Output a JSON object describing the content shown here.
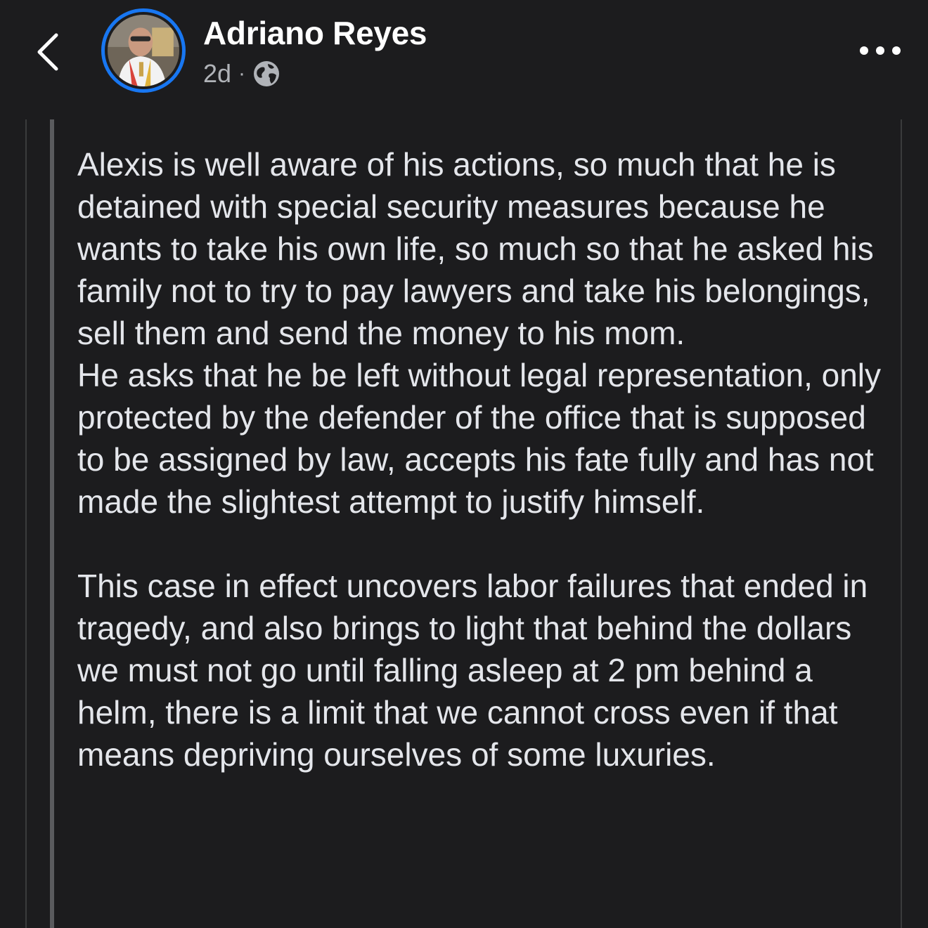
{
  "header": {
    "back_icon": "chevron-left-icon",
    "author_name": "Adriano Reyes",
    "timestamp": "2d",
    "separator": "·",
    "audience_icon": "globe-icon",
    "more_icon": "more-horizontal-icon",
    "accent_color": "#1877f2"
  },
  "post": {
    "paragraphs": [
      "Alexis is well aware of his actions, so much that he is detained with special security measures because he wants to take his own life, so much so that he asked his family not to try to pay lawyers and take his belongings, sell them and send the money to his mom.\nHe asks that he be left without legal representation, only protected by the defender of the office that is supposed to be assigned by law, accepts his fate fully and has not made the slightest attempt to justify himself.",
      "This case in effect uncovers labor failures that ended in tragedy, and also brings to light that behind the dollars we must not go until falling asleep at 2 pm behind a helm, there is a limit that we cannot cross even if that means depriving ourselves of some luxuries."
    ]
  }
}
